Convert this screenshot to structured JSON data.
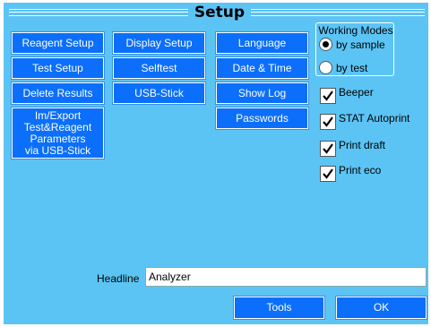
{
  "title": "Setup",
  "buttons": {
    "reagent_setup": "Reagent Setup",
    "test_setup": "Test Setup",
    "delete_results": "Delete Results",
    "im_export": "Im/Export\nTest&Reagent\nParameters\nvia  USB-Stick",
    "display_setup": "Display  Setup",
    "selftest": "Selftest",
    "usb_stick": "USB-Stick",
    "language": "Language",
    "date_time": "Date  &  Time",
    "show_log": "Show  Log",
    "passwords": "Passwords",
    "tools": "Tools",
    "ok": "OK"
  },
  "working_modes": {
    "label": "Working  Modes",
    "options": [
      {
        "label": "by  sample",
        "selected": true
      },
      {
        "label": "by  test",
        "selected": false
      }
    ]
  },
  "checkboxes": [
    {
      "label": "Beeper",
      "checked": true
    },
    {
      "label": "STAT  Autoprint",
      "checked": true
    },
    {
      "label": "Print  draft",
      "checked": true
    },
    {
      "label": "Print  eco",
      "checked": true
    }
  ],
  "headline": {
    "label": "Headline",
    "value": "Analyzer"
  },
  "colors": {
    "background": "#5bc4f5",
    "button": "#0b6ffb",
    "button_text": "#ffffff"
  }
}
